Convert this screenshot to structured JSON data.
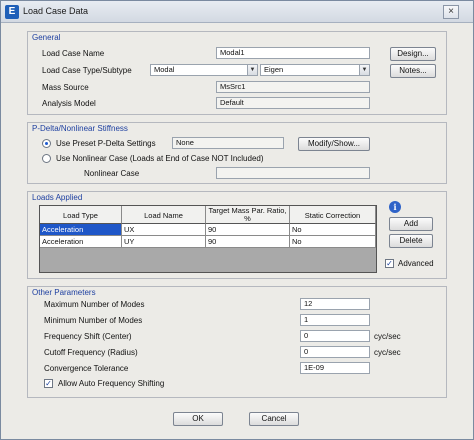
{
  "window": {
    "title": "Load Case Data",
    "close_glyph": "×"
  },
  "general": {
    "title": "General",
    "load_case_name_label": "Load Case Name",
    "load_case_name_value": "Modal1",
    "design_button": "Design...",
    "type_label": "Load Case Type/Subtype",
    "type_value": "Modal",
    "subtype_value": "Eigen",
    "notes_button": "Notes...",
    "mass_source_label": "Mass Source",
    "mass_source_value": "MsSrc1",
    "analysis_model_label": "Analysis Model",
    "analysis_model_value": "Default"
  },
  "pdelta": {
    "title": "P-Delta/Nonlinear Stiffness",
    "preset_label": "Use Preset P-Delta Settings",
    "preset_value": "None",
    "modify_button": "Modify/Show...",
    "nonlinear_label": "Use Nonlinear Case  (Loads at End of Case NOT Included)",
    "nonlinear_case_label": "Nonlinear Case",
    "nonlinear_case_value": ""
  },
  "loads": {
    "title": "Loads Applied",
    "columns": [
      "Load Type",
      "Load Name",
      "Target Mass Par. Ratio, %",
      "Static Correction"
    ],
    "rows": [
      [
        "Acceleration",
        "UX",
        "90",
        "No"
      ],
      [
        "Acceleration",
        "UY",
        "90",
        "No"
      ]
    ],
    "add_button": "Add",
    "delete_button": "Delete",
    "advanced_label": "Advanced",
    "info_glyph": "i"
  },
  "other": {
    "title": "Other Parameters",
    "max_modes_label": "Maximum Number of Modes",
    "max_modes_value": "12",
    "min_modes_label": "Minimum Number of Modes",
    "min_modes_value": "1",
    "freq_shift_label": "Frequency Shift  (Center)",
    "freq_shift_value": "0",
    "freq_shift_unit": "cyc/sec",
    "cutoff_label": "Cutoff Frequency  (Radius)",
    "cutoff_value": "0",
    "cutoff_unit": "cyc/sec",
    "tolerance_label": "Convergence Tolerance",
    "tolerance_value": "1E-09",
    "auto_shift_label": "Allow Auto Frequency Shifting"
  },
  "footer": {
    "ok_button": "OK",
    "cancel_button": "Cancel"
  },
  "colors": {
    "group_title": "#1d3fa0",
    "selection": "#1f57c8"
  }
}
